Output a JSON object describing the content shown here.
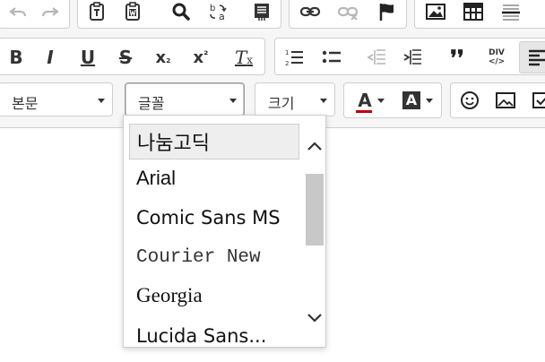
{
  "toolbar": {
    "row1": [
      "undo",
      "redo",
      "paste-text",
      "paste-word",
      "find",
      "replace",
      "document-props",
      "link",
      "unlink",
      "anchor",
      "image",
      "table",
      "horizontal-rule"
    ],
    "row2": [
      "bold",
      "italic",
      "underline",
      "strikethrough",
      "subscript",
      "superscript",
      "remove-format",
      "ordered-list",
      "unordered-list",
      "outdent",
      "indent",
      "blockquote",
      "div-block",
      "align-left"
    ],
    "row2_labels": {
      "bold": "B",
      "italic": "I",
      "underline": "U",
      "strikethrough": "S",
      "subscript_base": "x",
      "subscript_mark": "₂",
      "superscript_base": "x",
      "superscript_mark": "²",
      "remove_format": "T",
      "remove_format_mark": "x",
      "blockquote": "❜❜",
      "div_top": "DIV",
      "div_bottom": "</>"
    },
    "format_select": {
      "value": "본문"
    },
    "font_select": {
      "value": "글꼴",
      "open": true
    },
    "size_select": {
      "value": "크기"
    },
    "text_color": {
      "glyph": "A",
      "bar_color": "#c00000"
    },
    "bg_color": {
      "glyph": "A",
      "color": "#333333"
    }
  },
  "font_dropdown": {
    "items": [
      {
        "label": "나눔고딕",
        "selected": true
      },
      {
        "label": "Arial",
        "selected": false
      },
      {
        "label": "Comic Sans MS",
        "selected": false
      },
      {
        "label": "Courier New",
        "selected": false
      },
      {
        "label": "Georgia",
        "selected": false
      },
      {
        "label": "Lucida Sans...",
        "selected": false
      }
    ]
  },
  "colors": {
    "toolbar_bg": "#f6f6f6",
    "border": "#cfcfcf",
    "icon": "#333333",
    "scroll_thumb": "#c8c8c8"
  }
}
